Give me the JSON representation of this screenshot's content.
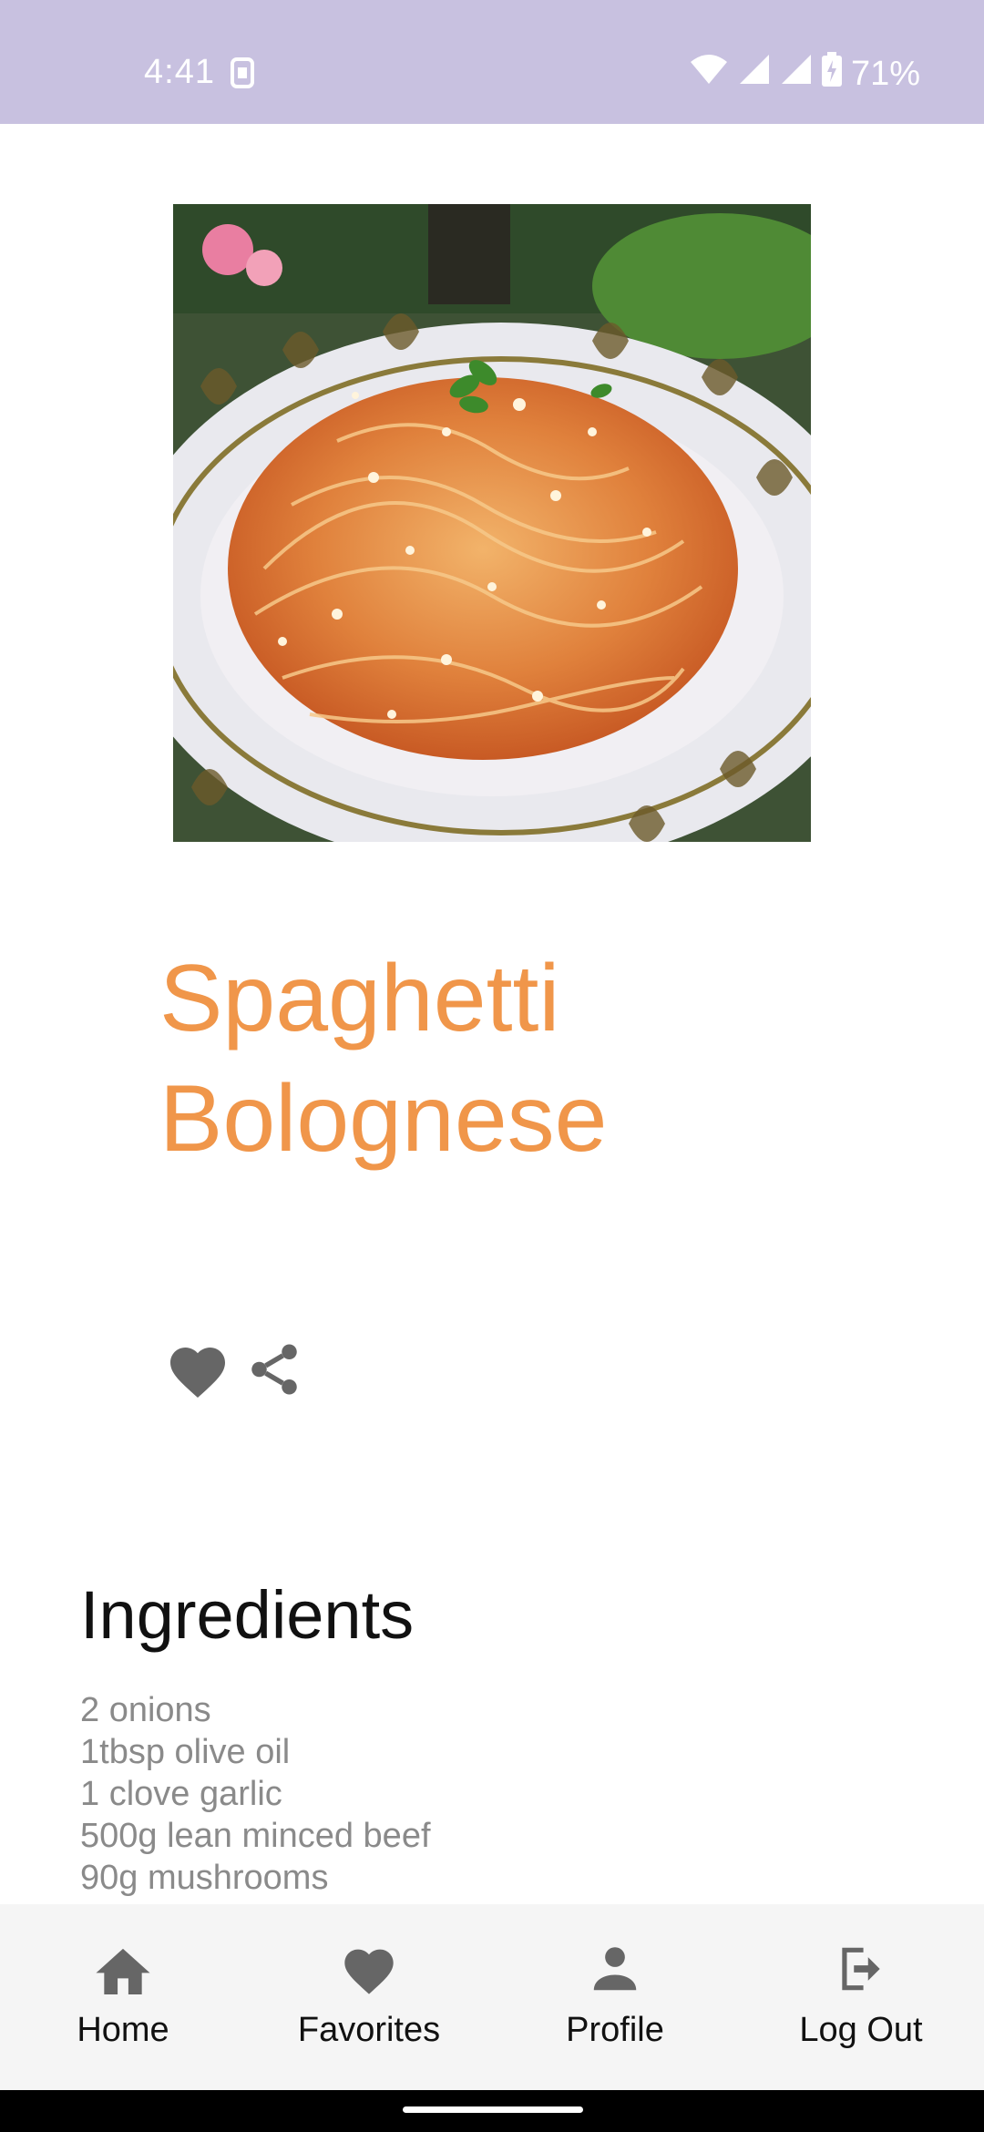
{
  "status_bar": {
    "time": "4:41",
    "battery": "71%",
    "icons": [
      "sim-icon",
      "wifi-icon",
      "signal-icon",
      "battery-charging-icon"
    ]
  },
  "recipe": {
    "title": "Spaghetti Bolognese",
    "title_color": "#f0964a",
    "image_description_icon": "recipe-photo",
    "actions": {
      "favorite_icon": "heart-icon",
      "share_icon": "share-icon"
    },
    "ingredients_heading": "Ingredients",
    "ingredients": [
      "2 onions",
      "1tbsp olive oil",
      "1 clove garlic",
      "500g lean minced beef",
      "90g mushrooms"
    ]
  },
  "bottom_nav": {
    "items": [
      {
        "label": "Home",
        "icon": "home-icon"
      },
      {
        "label": "Favorites",
        "icon": "heart-icon"
      },
      {
        "label": "Profile",
        "icon": "person-icon"
      },
      {
        "label": "Log Out",
        "icon": "logout-icon"
      }
    ]
  }
}
